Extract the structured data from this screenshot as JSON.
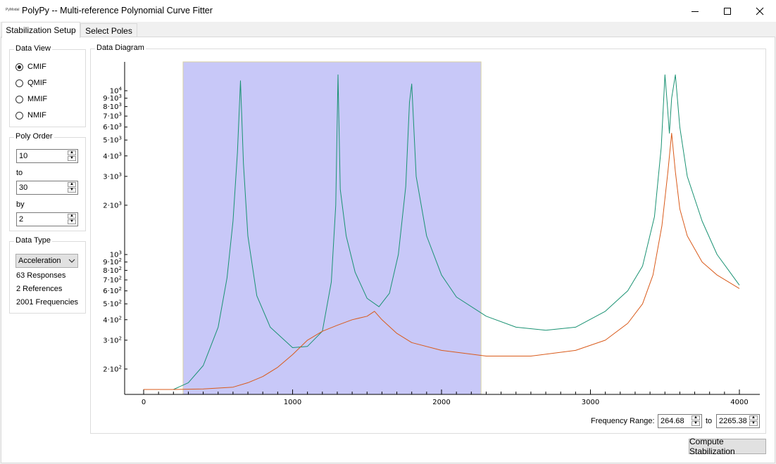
{
  "window": {
    "app_icon_text": "PyModal",
    "title": "PolyPy -- Multi-reference Polynomial Curve Fitter",
    "minimize_symbol": "—",
    "maximize_symbol": "☐",
    "close_symbol": "✕"
  },
  "tabs": [
    {
      "label": "Stabilization Setup",
      "active": true
    },
    {
      "label": "Select Poles",
      "active": false
    }
  ],
  "data_view": {
    "title": "Data View",
    "options": [
      {
        "label": "CMIF",
        "checked": true
      },
      {
        "label": "QMIF",
        "checked": false
      },
      {
        "label": "MMIF",
        "checked": false
      },
      {
        "label": "NMIF",
        "checked": false
      }
    ]
  },
  "poly_order": {
    "title": "Poly Order",
    "from": "10",
    "to_label": "to",
    "to": "30",
    "by_label": "by",
    "by": "2"
  },
  "data_type": {
    "title": "Data Type",
    "selected": "Acceleration",
    "responses": "63 Responses",
    "references": "2 References",
    "frequencies": "2001 Frequencies"
  },
  "diagram": {
    "title": "Data Diagram",
    "frequency_range_label": "Frequency Range:",
    "range_from": "264.68",
    "range_to_label": "to",
    "range_to": "2265.38"
  },
  "compute_button": "Compute Stabilization",
  "chart_data": {
    "type": "line",
    "x_scale": "linear",
    "y_scale": "log",
    "xlim": [
      0,
      4000
    ],
    "ylim": [
      140,
      15000
    ],
    "x_ticks": [
      0,
      1000,
      2000,
      3000,
      4000
    ],
    "x_tick_labels": [
      "0",
      "1000",
      "2000",
      "3000",
      "4000"
    ],
    "y_ticks": [
      200,
      300,
      400,
      500,
      600,
      700,
      800,
      900,
      1000,
      2000,
      3000,
      4000,
      5000,
      6000,
      7000,
      8000,
      9000,
      10000
    ],
    "y_tick_labels": [
      {
        "coef": "2",
        "exp": "2"
      },
      {
        "coef": "3",
        "exp": "2"
      },
      {
        "coef": "4",
        "exp": "2"
      },
      {
        "coef": "5",
        "exp": "2"
      },
      {
        "coef": "6",
        "exp": "2"
      },
      {
        "coef": "7",
        "exp": "2"
      },
      {
        "coef": "8",
        "exp": "2"
      },
      {
        "coef": "9",
        "exp": "2"
      },
      {
        "coef": "",
        "exp": "3"
      },
      {
        "coef": "2",
        "exp": "3"
      },
      {
        "coef": "3",
        "exp": "3"
      },
      {
        "coef": "4",
        "exp": "3"
      },
      {
        "coef": "5",
        "exp": "3"
      },
      {
        "coef": "6",
        "exp": "3"
      },
      {
        "coef": "7",
        "exp": "3"
      },
      {
        "coef": "8",
        "exp": "3"
      },
      {
        "coef": "9",
        "exp": "3"
      },
      {
        "coef": "",
        "exp": "4"
      }
    ],
    "selection": {
      "from": 264.68,
      "to": 2265.38,
      "color": "#c8c8f8"
    },
    "series": [
      {
        "color": "#1a9273",
        "x": [
          0,
          200,
          300,
          400,
          500,
          560,
          600,
          630,
          650,
          670,
          700,
          760,
          850,
          1000,
          1100,
          1200,
          1260,
          1290,
          1305,
          1320,
          1360,
          1420,
          1500,
          1580,
          1650,
          1710,
          1760,
          1785,
          1800,
          1830,
          1900,
          2000,
          2100,
          2300,
          2500,
          2700,
          2900,
          3100,
          3250,
          3350,
          3430,
          3475,
          3500,
          3515,
          3530,
          3545,
          3570,
          3600,
          3650,
          3750,
          3850,
          4000
        ],
        "y": [
          150,
          150,
          165,
          210,
          360,
          720,
          1600,
          4200,
          11500,
          3600,
          1300,
          560,
          360,
          270,
          275,
          340,
          680,
          2000,
          12500,
          2500,
          1300,
          780,
          540,
          480,
          580,
          1000,
          2600,
          8500,
          11000,
          3000,
          1300,
          750,
          550,
          420,
          360,
          345,
          360,
          450,
          600,
          850,
          1700,
          4500,
          12500,
          8500,
          5500,
          9000,
          12500,
          6000,
          3000,
          1600,
          1000,
          650
        ]
      },
      {
        "color": "#d95a1a",
        "x": [
          0,
          200,
          400,
          600,
          700,
          800,
          900,
          1000,
          1100,
          1200,
          1300,
          1400,
          1500,
          1550,
          1600,
          1700,
          1800,
          2000,
          2300,
          2600,
          2900,
          3100,
          3250,
          3350,
          3420,
          3480,
          3520,
          3545,
          3570,
          3600,
          3650,
          3750,
          3850,
          4000
        ],
        "y": [
          150,
          150,
          151,
          155,
          165,
          180,
          205,
          245,
          300,
          340,
          370,
          400,
          420,
          450,
          400,
          330,
          290,
          260,
          240,
          240,
          260,
          300,
          380,
          500,
          750,
          1500,
          3200,
          5500,
          3200,
          1900,
          1300,
          900,
          750,
          620
        ]
      }
    ]
  }
}
